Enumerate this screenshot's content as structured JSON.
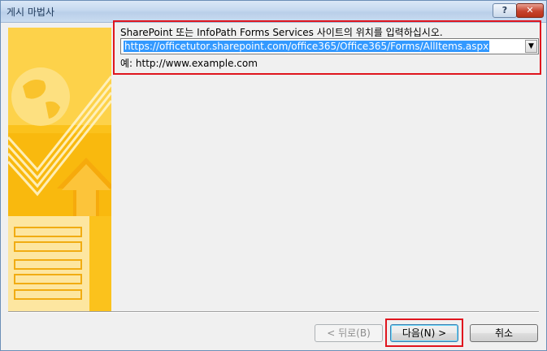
{
  "window": {
    "title": "게시 마법사",
    "help_label": "?",
    "close_label": "✕"
  },
  "location": {
    "prompt": "SharePoint 또는 InfoPath Forms Services 사이트의 위치를 입력하십시오.",
    "value": "https://officetutor.sharepoint.com/office365/Office365/Forms/AllItems.aspx",
    "dropdown_icon": "chevron-down-icon",
    "example": "예: http://www.example.com"
  },
  "buttons": {
    "back": "< 뒤로(B)",
    "next": "다음(N) >",
    "cancel": "취소"
  },
  "colors": {
    "highlight": "#e0151e",
    "selection": "#3399ff",
    "art_yellow": "#fbc21c"
  }
}
